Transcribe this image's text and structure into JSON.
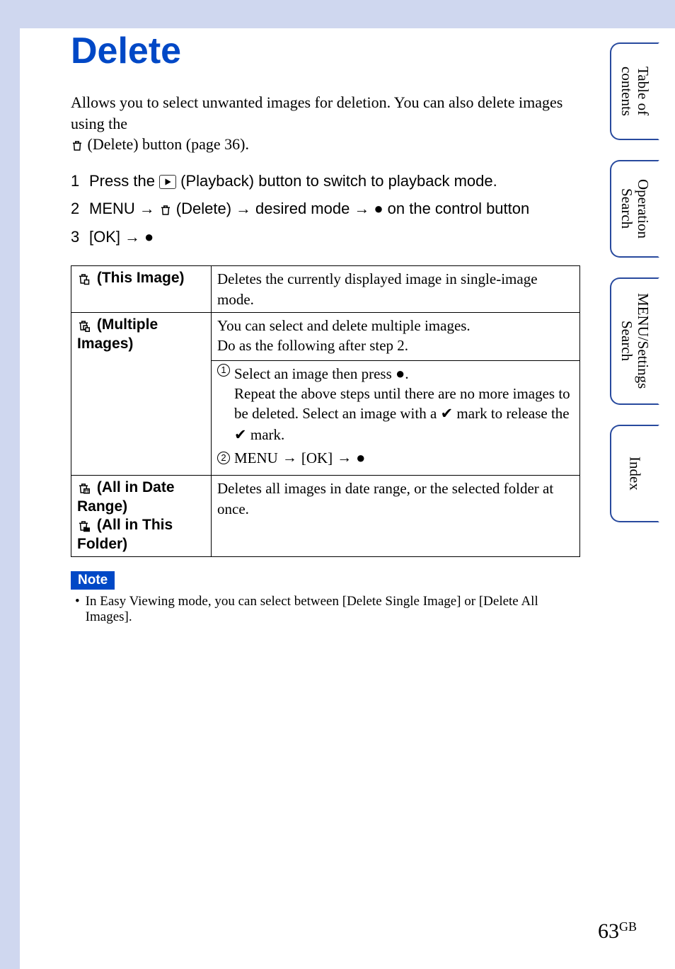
{
  "title": "Delete",
  "intro_line1": "Allows you to select unwanted images for deletion. You can also delete images using the",
  "intro_line2": " (Delete) button (page 36).",
  "steps": {
    "s1_num": "1",
    "s1_a": "Press the ",
    "s1_b": " (Playback) button to switch to playback mode.",
    "s2_num": "2",
    "s2_a": "MENU ",
    "s2_b": " (Delete) ",
    "s2_c": " desired mode ",
    "s2_d": " on the control button",
    "s3_num": "3",
    "s3_a": "[OK] "
  },
  "table": {
    "r1_left": " (This Image)",
    "r1_right": "Deletes the currently displayed image in single-image mode.",
    "r2_left": " (Multiple Images)",
    "r2_right_a": "You can select and delete multiple images.",
    "r2_right_b": "Do as the following after step 2.",
    "r2_sub_1a": "Select an image then press ",
    "r2_sub_1b": ".",
    "r2_sub_1c": "Repeat the above steps until there are no more images to be deleted. Select an image with a ",
    "r2_sub_1d": " mark to release the ",
    "r2_sub_1e": " mark.",
    "r2_sub_2": "MENU ",
    "r2_sub_2b": " [OK] ",
    "r3_left_a": " (All in Date Range)",
    "r3_left_b": " (All in This Folder)",
    "r3_right": "Deletes all images in date range, or the selected folder at once."
  },
  "note_label": "Note",
  "note_body": "In Easy Viewing mode, you can select between [Delete Single Image] or [Delete All Images].",
  "tabs": {
    "t1": "Table of contents",
    "t2": "Operation Search",
    "t3": "MENU/Settings Search",
    "t4": "Index"
  },
  "page_number": "63",
  "page_region": "GB"
}
